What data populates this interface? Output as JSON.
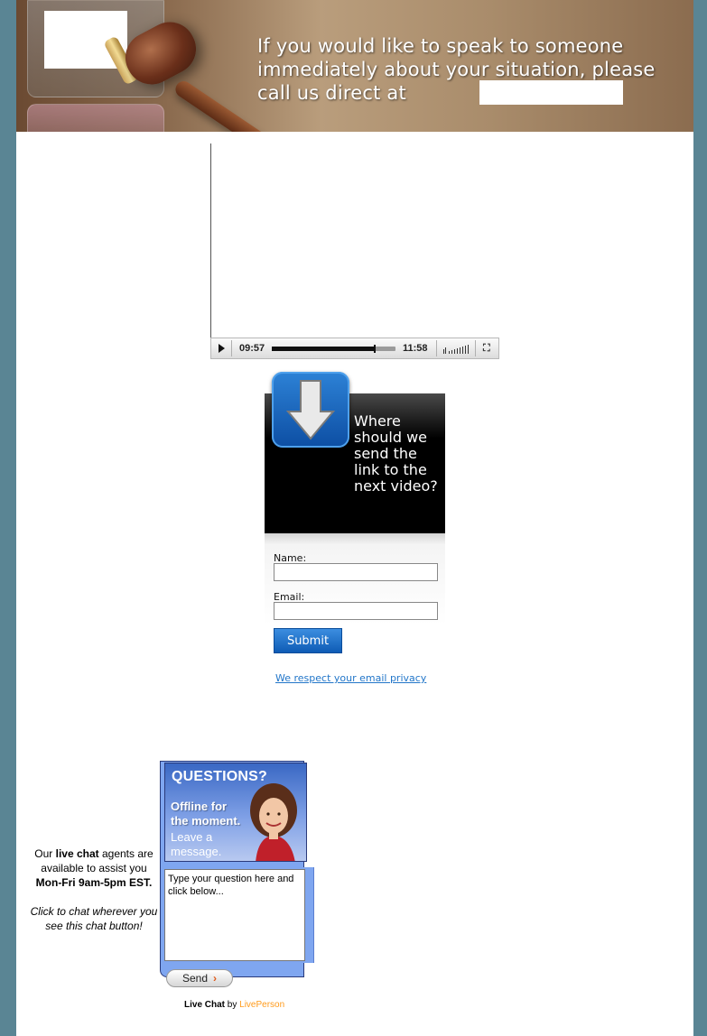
{
  "header": {
    "headline": "If you would like to speak to someone immediately about your situation, please call us direct at"
  },
  "video_player": {
    "current_time": "09:57",
    "total_time": "11:58",
    "progress_fraction": 0.83
  },
  "optin": {
    "cta": "Where should we send the link to the next video?",
    "name_label": "Name:",
    "name_value": "",
    "email_label": "Email:",
    "email_value": "",
    "submit_label": "Submit",
    "privacy_link": "We respect your email privacy"
  },
  "live_chat": {
    "note_line1_pre": "Our ",
    "note_line1_bold": "live chat",
    "note_line1_post": " agents are available to assist you",
    "note_hours": "Mon-Fri 9am-5pm EST.",
    "note_italic": "Click to chat wherever you see this chat button!",
    "widget_title": "QUESTIONS?",
    "widget_offline": "Offline for the moment.",
    "widget_leave": "Leave a message.",
    "question_placeholder": "Type your question here and click below...",
    "send_label": "Send",
    "credit_bold": "Live Chat",
    "credit_by": " by ",
    "credit_brand": "LivePerson"
  },
  "colors": {
    "background": "#5a8594",
    "submit_button": "#1565c0",
    "privacy_link": "#2276c9",
    "liveperson_orange": "#ff9a1a"
  }
}
